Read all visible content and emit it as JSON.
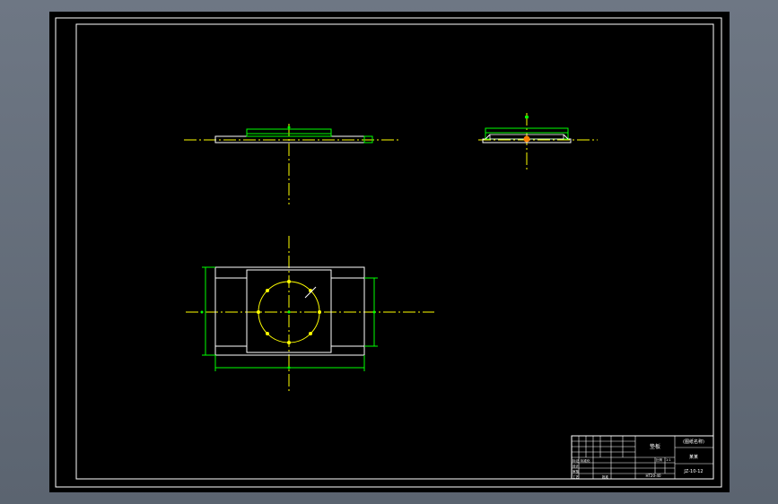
{
  "colors": {
    "background": "#000000",
    "frame": "#ffffff",
    "outline": "#ffffff",
    "feature": "#00ff00",
    "centerline": "#ffff00",
    "highlight": "#ff8000",
    "titleblock_text": "#ffffff"
  },
  "title_block": {
    "part_name": "垫板",
    "project_title": "(图纸名称)",
    "company": "某某",
    "drawing_number": "JZ-10-12",
    "material": "HT20-40",
    "grid_labels": [
      "标记",
      "设计",
      "审核",
      "工艺",
      "标准化",
      "批准",
      "比例",
      "1:1"
    ]
  }
}
